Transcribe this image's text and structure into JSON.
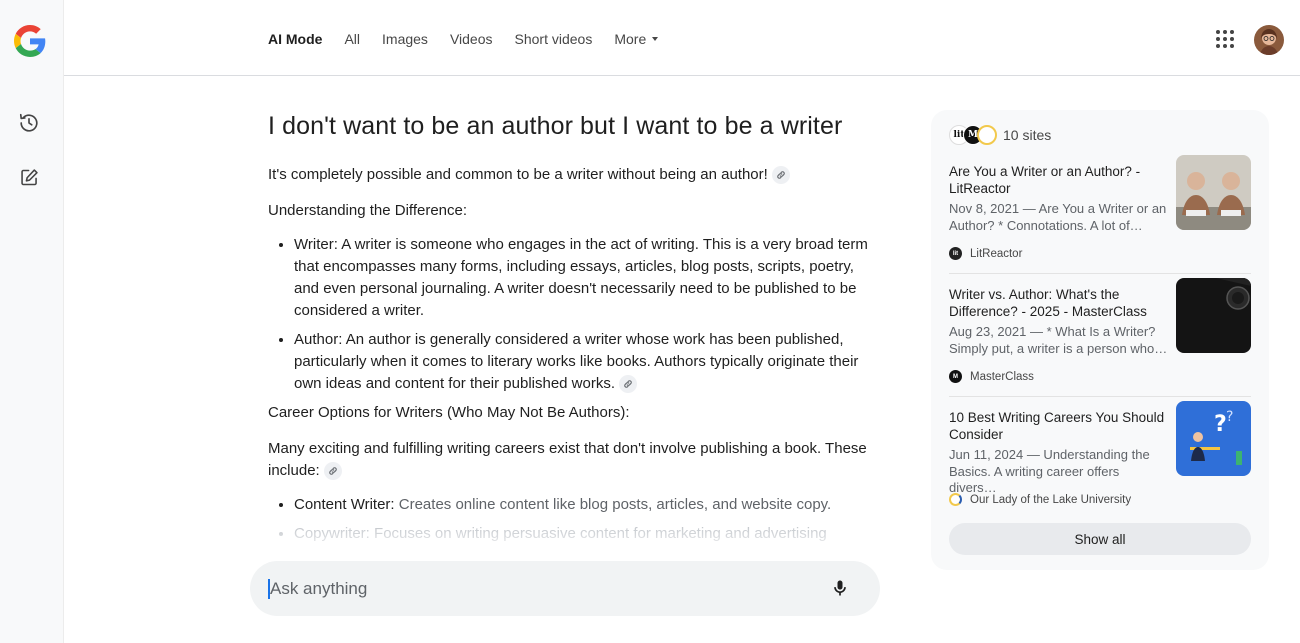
{
  "header": {
    "tabs": [
      {
        "label": "AI Mode",
        "active": true
      },
      {
        "label": "All"
      },
      {
        "label": "Images"
      },
      {
        "label": "Videos"
      },
      {
        "label": "Short videos"
      },
      {
        "label": "More"
      }
    ]
  },
  "article": {
    "title": "I don't want to be an author but I want to be a writer",
    "intro": "It's completely possible and common to be a writer without being an author!",
    "section1_heading": "Understanding the Difference:",
    "definitions": [
      {
        "term": "Writer:",
        "text": " A writer is someone who engages in the act of writing. This is a very broad term that encompasses many forms, including essays, articles, blog posts, scripts, poetry, and even personal journaling. A writer doesn't necessarily need to be published to be considered a writer."
      },
      {
        "term": "Author:",
        "text": " An author is generally considered a writer whose work has been published, particularly when it comes to literary works like books. Authors typically originate their own ideas and content for their published works."
      }
    ],
    "section2_heading": "Career Options for Writers (Who May Not Be Authors):",
    "section2_intro": "Many exciting and fulfilling writing careers exist that don't involve publishing a book. These include:",
    "careers": [
      {
        "term": "Content Writer:",
        "text": " Creates online content like blog posts, articles, and website copy."
      },
      {
        "term": "Copywriter:",
        "text": " Focuses on writing persuasive content for marketing and advertising"
      }
    ]
  },
  "askbar": {
    "placeholder": "Ask anything"
  },
  "sources": {
    "count_label": "10 sites",
    "items": [
      {
        "title": "Are You a Writer or an Author? - LitReactor",
        "snippet": "Nov 8, 2021 — Are You a Writer or an Author? * Connotations. A lot of…",
        "site": "LitReactor"
      },
      {
        "title": "Writer vs. Author: What's the Difference? - 2025 - MasterClass",
        "snippet": "Aug 23, 2021 — * What Is a Writer? Simply put, a writer is a person who…",
        "site": "MasterClass"
      },
      {
        "title": "10 Best Writing Careers You Should Consider",
        "snippet": "Jun 11, 2024 — Understanding the Basics. A writing career offers divers…",
        "site": "Our Lady of the Lake University"
      }
    ],
    "show_all": "Show all"
  },
  "colors": {
    "accent": "#1a73e8",
    "panel_bg": "#f8f9fa",
    "text": "#1f1f1f",
    "muted": "#5f6368"
  }
}
